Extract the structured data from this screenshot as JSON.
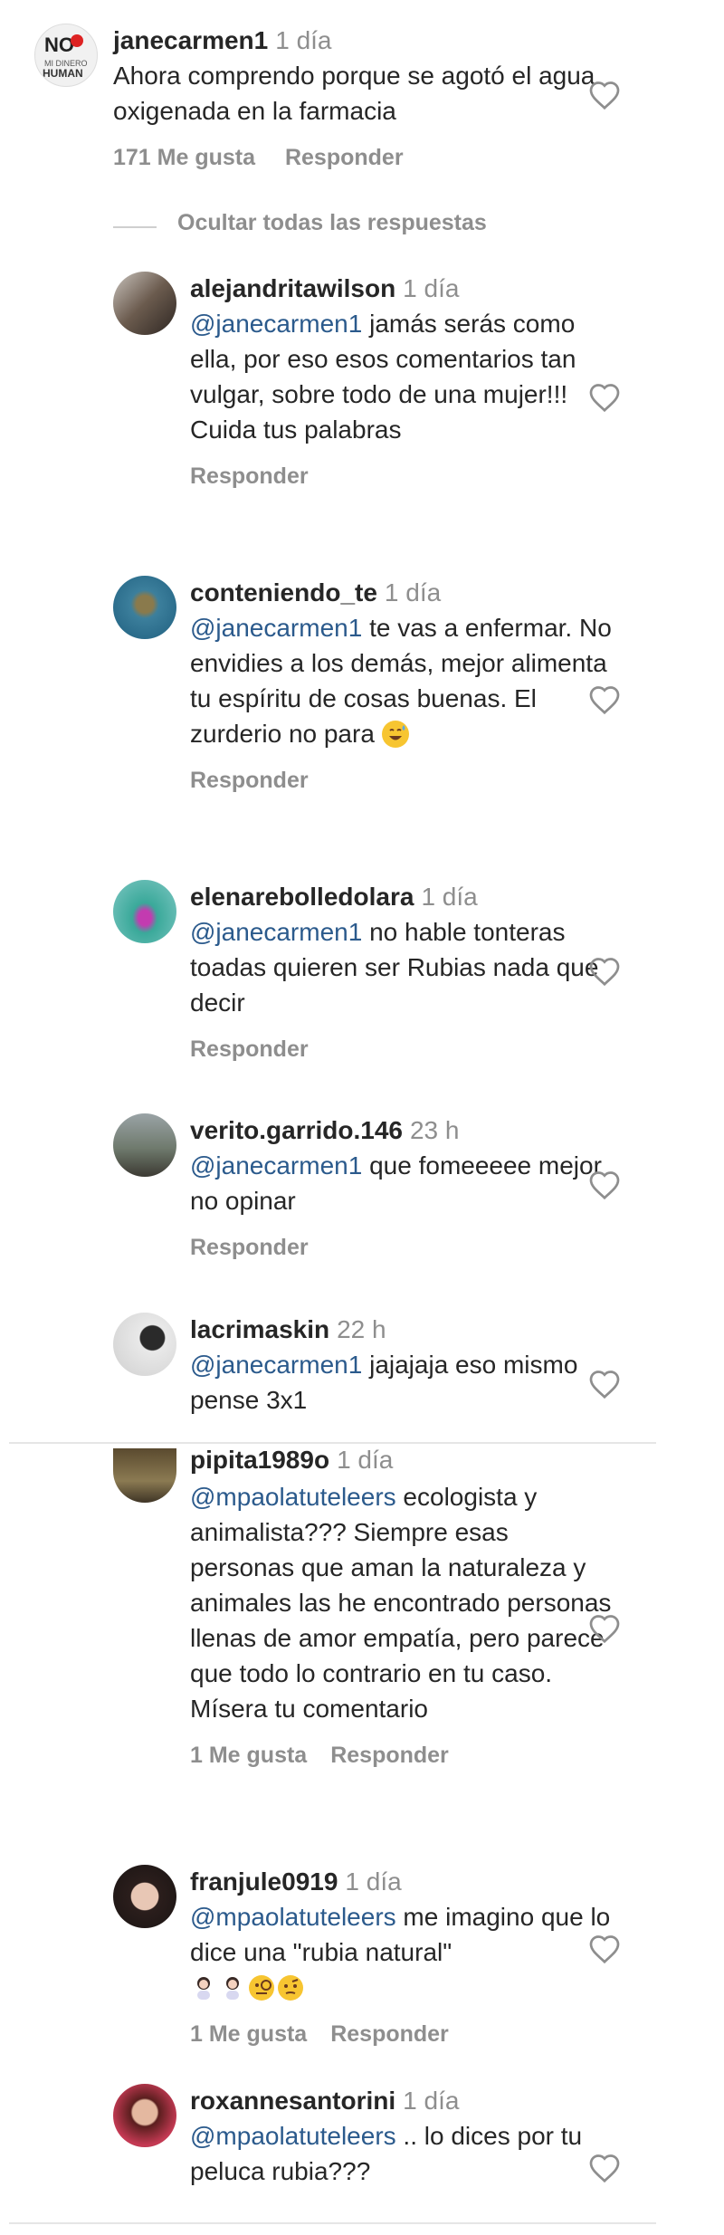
{
  "top_comment": {
    "username": "janecarmen1",
    "time": "1 día",
    "text": "Ahora comprendo porque se agotó el agua oxigenada en la farmacia",
    "likes": "171 Me gusta",
    "reply": "Responder"
  },
  "hide_replies_label": "Ocultar todas las respuestas",
  "replies": [
    {
      "username": "alejandritawilson",
      "time": "1 día",
      "mention": "@janecarmen1",
      "text": " jamás serás como ella, por eso esos comentarios tan vulgar, sobre todo de una mujer!!! Cuida tus palabras",
      "reply": "Responder"
    },
    {
      "username": "conteniendo_te",
      "time": "1 día",
      "mention": "@janecarmen1",
      "text": " te vas a enfermar. No envidies a los demás, mejor alimenta tu espíritu de cosas buenas. El zurderio no para",
      "reply": "Responder"
    },
    {
      "username": "elenarebolledolara",
      "time": "1 día",
      "mention": "@janecarmen1",
      "text": " no hable tonteras toadas quieren ser Rubias nada que decir",
      "reply": "Responder"
    },
    {
      "username": "verito.garrido.146",
      "time": "23 h",
      "mention": "@janecarmen1",
      "text": " que fomeeeee mejor no opinar",
      "reply": "Responder"
    },
    {
      "username": "lacrimaskin",
      "time": "22 h",
      "mention": "@janecarmen1",
      "text": " jajajaja eso mismo pense 3x1"
    },
    {
      "username": "pipita1989o",
      "time": "1 día",
      "mention": "@mpaolatuteleers",
      "text": " ecologista y animalista??? Siempre esas personas que aman la naturaleza y animales las he encontrado personas llenas de amor empatía, pero parece que todo lo contrario en tu caso. Mísera tu comentario",
      "likes": "1 Me gusta",
      "reply": "Responder"
    },
    {
      "username": "franjule0919",
      "time": "1 día",
      "mention": "@mpaolatuteleers",
      "text": " me imagino que lo dice una \"rubia natural\"",
      "likes": "1 Me gusta",
      "reply": "Responder"
    },
    {
      "username": "roxannesantorini",
      "time": "1 día",
      "mention": "@mpaolatuteleers",
      "text": " .. lo dices por tu peluca rubia???"
    }
  ],
  "icons": {
    "like": "heart-outline-icon",
    "emoji_sweat_smile": "grinning-sweat-emoji",
    "emoji_woman_gesture": "woman-gesture-emoji",
    "emoji_monocle": "face-with-monocle-emoji",
    "emoji_raised_eyebrow": "face-raised-eyebrow-emoji"
  },
  "colors": {
    "mention": "#2b5a8c",
    "muted": "#8e8e8e",
    "text": "#262626"
  }
}
